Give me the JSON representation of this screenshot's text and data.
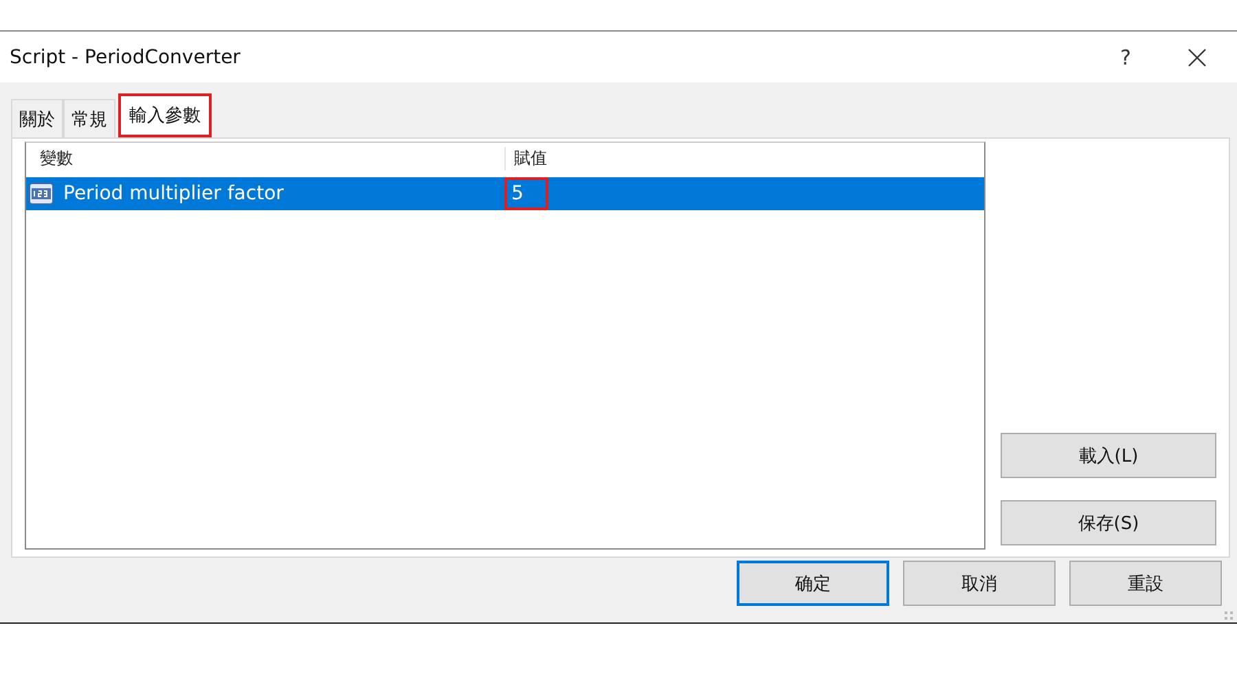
{
  "window": {
    "title": "Script - PeriodConverter",
    "help": "?"
  },
  "tabs": [
    {
      "label": "關於",
      "selected": false,
      "highlighted": false
    },
    {
      "label": "常規",
      "selected": false,
      "highlighted": false
    },
    {
      "label": "輸入參數",
      "selected": true,
      "highlighted": true
    }
  ],
  "table": {
    "columns": [
      "變數",
      "賦值"
    ],
    "rows": [
      {
        "name": "Period multiplier factor",
        "value": "5",
        "selected": true,
        "value_highlighted": true
      }
    ]
  },
  "side_buttons": [
    "載入(L)",
    "保存(S)"
  ],
  "buttons": [
    {
      "label": "确定",
      "default": true
    },
    {
      "label": "取消",
      "default": false
    },
    {
      "label": "重設",
      "default": false
    }
  ]
}
